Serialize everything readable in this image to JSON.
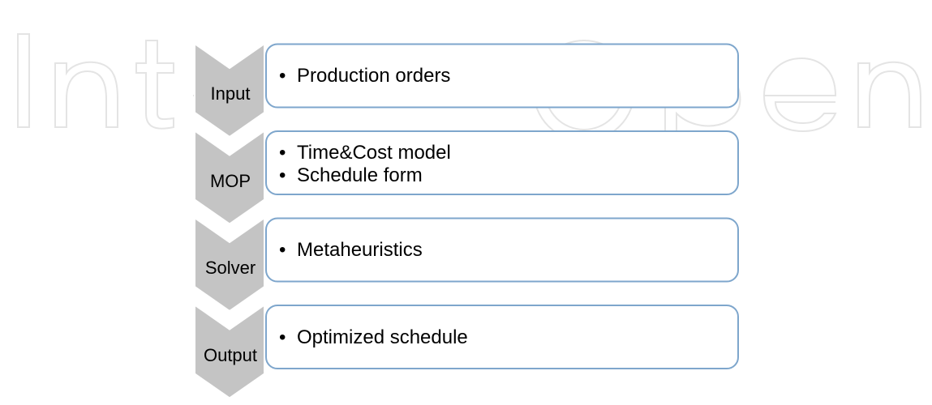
{
  "watermark": {
    "text": "IntechOpen"
  },
  "steps": [
    {
      "label": "Input",
      "items": [
        "Production orders"
      ]
    },
    {
      "label": "MOP",
      "items": [
        "Time&Cost model",
        "Schedule form"
      ]
    },
    {
      "label": "Solver",
      "items": [
        "Metaheuristics"
      ]
    },
    {
      "label": "Output",
      "items": [
        "Optimized schedule"
      ]
    }
  ],
  "colors": {
    "chevron_fill": "#c4c4c4",
    "chevron_stroke": "#ffffff",
    "box_fill": "#ffffff",
    "box_stroke": "#7ea6cc",
    "watermark_stroke": "#e4e4e4"
  }
}
